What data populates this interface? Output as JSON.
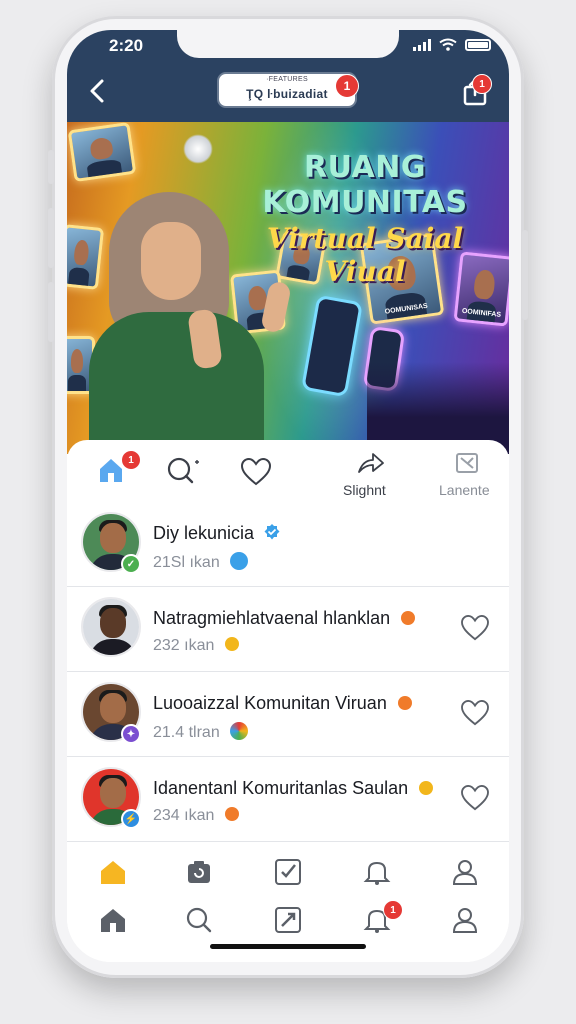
{
  "status_bar": {
    "time": "2:20"
  },
  "header": {
    "title_top": "·FEATURES",
    "title": "ŢQ ŀbuizadiat",
    "title_badge": "1",
    "share_badge": "1"
  },
  "hero": {
    "title_line1": "RUANG KOMUNITAS",
    "title_line2": "Virtual Saial Viual",
    "card_label_1": "OOMUNISAS",
    "card_label_2": "OOMINIFAS"
  },
  "toolbar": {
    "home_badge": "1",
    "share_label": "Slighnt",
    "lanente_label": "Lanente"
  },
  "feed": [
    {
      "title": "Diy lekunicia",
      "sub": "21Sl ıkan",
      "verified": true,
      "badge_color": "#4caf50",
      "emoji_color": "#3aa0e8",
      "bg": "#4d8a57"
    },
    {
      "title": "Natragmiehlatvaenal hlanklan",
      "sub": "232 ıkan",
      "verified": false,
      "badge_color": "",
      "emoji_color": "#f2b61b",
      "bg": "#d9dde3",
      "title_emoji_color": "#f07b2a"
    },
    {
      "title": "Luooaizzal Komunitan Viruan",
      "sub": "21.4 tlran",
      "verified": false,
      "badge_color": "#7b4fd0",
      "emoji_color": "#3aa0e8",
      "bg": "#6a4730",
      "title_emoji_color": "#f07b2a"
    },
    {
      "title": "Idanentanl Komuritanlas Saulan",
      "sub": "234 ıkan",
      "verified": false,
      "badge_color": "#2e8de0",
      "emoji_color": "#f07b2a",
      "bg": "#e0352b",
      "title_emoji_color": "#f2b61b"
    }
  ],
  "bottom_nav": {
    "notifications_badge": "1"
  },
  "colors": {
    "header_bg": "#2b4261",
    "badge": "#e53935",
    "accent_home": "#f6b622",
    "verified": "#3aa0e8"
  }
}
